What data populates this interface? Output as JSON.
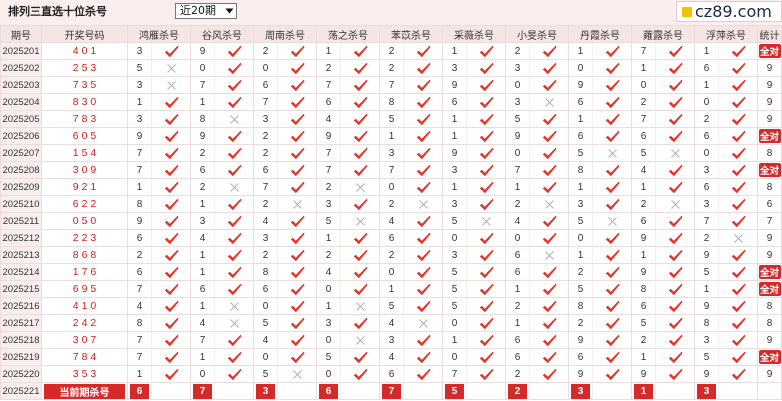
{
  "topbar": {
    "title": "排列三直选十位杀号",
    "period_select": {
      "selected": "近20期"
    },
    "logo": {
      "icon": "logo-square-icon",
      "text": "cz89.com"
    }
  },
  "colors": {
    "topbar_bg": "#fbeeee",
    "header_bg": "#f5e5e5",
    "period_bg": "#f8eeee",
    "draw_digits": "#d21f1f",
    "check": "#e3342b",
    "cross": "#b7b7b7",
    "badge": "#d42a2a",
    "logo_yellow": "#f2c200",
    "grid_line": "#ecdcdc"
  },
  "table": {
    "headers": {
      "period": "期号",
      "draw": "开奖号码",
      "stat": "统计"
    },
    "experts": [
      "鸿雁杀号",
      "谷风杀号",
      "周南杀号",
      "荡之杀号",
      "苯苡杀号",
      "采薇杀号",
      "小旻杀号",
      "丹霞杀号",
      "蕹露杀号",
      "浮萍杀号"
    ],
    "rows": [
      {
        "period": "2025201",
        "draw": "401",
        "nums": [
          3,
          9,
          2,
          1,
          2,
          1,
          2,
          1,
          7,
          1
        ],
        "marks": [
          "check-icon",
          "check-icon",
          "check-icon",
          "check-icon",
          "check-icon",
          "check-icon",
          "check-icon",
          "check-icon",
          "check-icon",
          "check-icon"
        ],
        "stat": "全对"
      },
      {
        "period": "2025202",
        "draw": "253",
        "nums": [
          5,
          0,
          0,
          2,
          2,
          3,
          3,
          0,
          1,
          6
        ],
        "marks": [
          "cross-icon",
          "check-icon",
          "check-icon",
          "check-icon",
          "check-icon",
          "check-icon",
          "check-icon",
          "check-icon",
          "check-icon",
          "check-icon"
        ],
        "stat": "9"
      },
      {
        "period": "2025203",
        "draw": "735",
        "nums": [
          3,
          7,
          6,
          7,
          7,
          9,
          0,
          9,
          0,
          1
        ],
        "marks": [
          "cross-icon",
          "check-icon",
          "check-icon",
          "check-icon",
          "check-icon",
          "check-icon",
          "check-icon",
          "check-icon",
          "check-icon",
          "check-icon"
        ],
        "stat": "9"
      },
      {
        "period": "2025204",
        "draw": "830",
        "nums": [
          1,
          1,
          7,
          6,
          8,
          6,
          3,
          6,
          2,
          0
        ],
        "marks": [
          "check-icon",
          "check-icon",
          "check-icon",
          "check-icon",
          "check-icon",
          "check-icon",
          "cross-icon",
          "check-icon",
          "check-icon",
          "check-icon"
        ],
        "stat": "9"
      },
      {
        "period": "2025205",
        "draw": "783",
        "nums": [
          3,
          8,
          3,
          4,
          5,
          1,
          5,
          1,
          7,
          2
        ],
        "marks": [
          "check-icon",
          "cross-icon",
          "check-icon",
          "check-icon",
          "check-icon",
          "check-icon",
          "check-icon",
          "check-icon",
          "check-icon",
          "check-icon"
        ],
        "stat": "9"
      },
      {
        "period": "2025206",
        "draw": "605",
        "nums": [
          9,
          9,
          2,
          9,
          1,
          1,
          9,
          6,
          6,
          6
        ],
        "marks": [
          "check-icon",
          "check-icon",
          "check-icon",
          "check-icon",
          "check-icon",
          "check-icon",
          "check-icon",
          "check-icon",
          "check-icon",
          "check-icon"
        ],
        "stat": "全对"
      },
      {
        "period": "2025207",
        "draw": "154",
        "nums": [
          7,
          2,
          2,
          7,
          3,
          9,
          0,
          5,
          5,
          0
        ],
        "marks": [
          "check-icon",
          "check-icon",
          "check-icon",
          "check-icon",
          "check-icon",
          "check-icon",
          "check-icon",
          "cross-icon",
          "cross-icon",
          "check-icon"
        ],
        "stat": "8"
      },
      {
        "period": "2025208",
        "draw": "309",
        "nums": [
          7,
          6,
          6,
          7,
          7,
          3,
          7,
          8,
          4,
          3
        ],
        "marks": [
          "check-icon",
          "check-icon",
          "check-icon",
          "check-icon",
          "check-icon",
          "check-icon",
          "check-icon",
          "check-icon",
          "check-icon",
          "check-icon"
        ],
        "stat": "全对"
      },
      {
        "period": "2025209",
        "draw": "921",
        "nums": [
          1,
          2,
          7,
          2,
          0,
          1,
          1,
          1,
          1,
          6
        ],
        "marks": [
          "check-icon",
          "cross-icon",
          "check-icon",
          "cross-icon",
          "check-icon",
          "check-icon",
          "check-icon",
          "check-icon",
          "check-icon",
          "check-icon"
        ],
        "stat": "8"
      },
      {
        "period": "2025210",
        "draw": "622",
        "nums": [
          8,
          1,
          2,
          3,
          2,
          3,
          2,
          3,
          2,
          3
        ],
        "marks": [
          "check-icon",
          "check-icon",
          "cross-icon",
          "check-icon",
          "cross-icon",
          "check-icon",
          "cross-icon",
          "check-icon",
          "cross-icon",
          "check-icon"
        ],
        "stat": "6"
      },
      {
        "period": "2025211",
        "draw": "050",
        "nums": [
          9,
          3,
          4,
          5,
          4,
          5,
          4,
          5,
          6,
          7
        ],
        "marks": [
          "check-icon",
          "check-icon",
          "check-icon",
          "cross-icon",
          "check-icon",
          "cross-icon",
          "check-icon",
          "cross-icon",
          "check-icon",
          "check-icon"
        ],
        "stat": "7"
      },
      {
        "period": "2025212",
        "draw": "223",
        "nums": [
          6,
          4,
          3,
          1,
          6,
          0,
          0,
          0,
          9,
          2
        ],
        "marks": [
          "check-icon",
          "check-icon",
          "check-icon",
          "check-icon",
          "check-icon",
          "check-icon",
          "check-icon",
          "check-icon",
          "check-icon",
          "cross-icon"
        ],
        "stat": "9"
      },
      {
        "period": "2025213",
        "draw": "868",
        "nums": [
          2,
          1,
          2,
          2,
          2,
          3,
          6,
          1,
          1,
          9
        ],
        "marks": [
          "check-icon",
          "check-icon",
          "check-icon",
          "check-icon",
          "check-icon",
          "check-icon",
          "cross-icon",
          "check-icon",
          "check-icon",
          "check-icon"
        ],
        "stat": "9"
      },
      {
        "period": "2025214",
        "draw": "176",
        "nums": [
          6,
          1,
          8,
          4,
          0,
          5,
          6,
          2,
          9,
          5
        ],
        "marks": [
          "check-icon",
          "check-icon",
          "check-icon",
          "check-icon",
          "check-icon",
          "check-icon",
          "check-icon",
          "check-icon",
          "check-icon",
          "check-icon"
        ],
        "stat": "全对"
      },
      {
        "period": "2025215",
        "draw": "695",
        "nums": [
          7,
          6,
          6,
          0,
          1,
          5,
          1,
          5,
          8,
          1
        ],
        "marks": [
          "check-icon",
          "check-icon",
          "check-icon",
          "check-icon",
          "check-icon",
          "check-icon",
          "check-icon",
          "check-icon",
          "check-icon",
          "check-icon"
        ],
        "stat": "全对"
      },
      {
        "period": "2025216",
        "draw": "410",
        "nums": [
          4,
          1,
          0,
          1,
          5,
          5,
          2,
          8,
          6,
          9
        ],
        "marks": [
          "check-icon",
          "cross-icon",
          "check-icon",
          "cross-icon",
          "check-icon",
          "check-icon",
          "check-icon",
          "check-icon",
          "check-icon",
          "check-icon"
        ],
        "stat": "8"
      },
      {
        "period": "2025217",
        "draw": "242",
        "nums": [
          8,
          4,
          5,
          3,
          4,
          0,
          1,
          2,
          5,
          8
        ],
        "marks": [
          "check-icon",
          "cross-icon",
          "check-icon",
          "check-icon",
          "cross-icon",
          "check-icon",
          "check-icon",
          "check-icon",
          "check-icon",
          "check-icon"
        ],
        "stat": "8"
      },
      {
        "period": "2025218",
        "draw": "307",
        "nums": [
          7,
          7,
          4,
          0,
          3,
          1,
          6,
          9,
          2,
          3
        ],
        "marks": [
          "check-icon",
          "check-icon",
          "check-icon",
          "cross-icon",
          "check-icon",
          "check-icon",
          "check-icon",
          "check-icon",
          "check-icon",
          "check-icon"
        ],
        "stat": "9"
      },
      {
        "period": "2025219",
        "draw": "784",
        "nums": [
          7,
          1,
          0,
          5,
          4,
          0,
          6,
          6,
          1,
          5
        ],
        "marks": [
          "check-icon",
          "check-icon",
          "check-icon",
          "check-icon",
          "check-icon",
          "check-icon",
          "check-icon",
          "check-icon",
          "check-icon",
          "check-icon"
        ],
        "stat": "全对"
      },
      {
        "period": "2025220",
        "draw": "353",
        "nums": [
          1,
          0,
          5,
          0,
          6,
          7,
          2,
          9,
          9,
          9
        ],
        "marks": [
          "check-icon",
          "check-icon",
          "cross-icon",
          "check-icon",
          "check-icon",
          "check-icon",
          "check-icon",
          "check-icon",
          "check-icon",
          "check-icon"
        ],
        "stat": "9"
      }
    ],
    "current": {
      "period": "2025221",
      "label": "当前期杀号",
      "nums": [
        6,
        7,
        3,
        6,
        7,
        5,
        2,
        3,
        1,
        3
      ]
    }
  }
}
